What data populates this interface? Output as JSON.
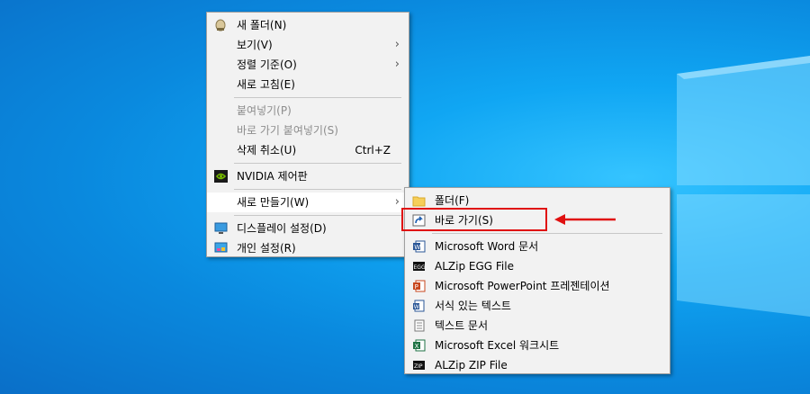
{
  "context_menu": {
    "items": [
      {
        "label": "새 폴더(N)",
        "icon": "new-folder-icon"
      },
      {
        "label": "보기(V)",
        "submenu": true
      },
      {
        "label": "정렬 기준(O)",
        "submenu": true
      },
      {
        "label": "새로 고침(E)"
      },
      {
        "label": "붙여넣기(P)",
        "disabled": true
      },
      {
        "label": "바로 가기 붙여넣기(S)",
        "disabled": true
      },
      {
        "label": "삭제 취소(U)",
        "shortcut": "Ctrl+Z"
      },
      {
        "label": "NVIDIA 제어판",
        "icon": "nvidia-icon"
      },
      {
        "label": "새로 만들기(W)",
        "submenu": true,
        "highlighted": true
      },
      {
        "label": "디스플레이 설정(D)",
        "icon": "display-icon"
      },
      {
        "label": "개인 설정(R)",
        "icon": "personalize-icon"
      }
    ]
  },
  "new_submenu": {
    "items": [
      {
        "label": "폴더(F)",
        "icon": "folder-icon"
      },
      {
        "label": "바로 가기(S)",
        "icon": "shortcut-icon",
        "highlighted": true
      },
      {
        "label": "Microsoft Word 문서",
        "icon": "word-icon"
      },
      {
        "label": "ALZip EGG File",
        "icon": "egg-icon"
      },
      {
        "label": "Microsoft PowerPoint 프레젠테이션",
        "icon": "powerpoint-icon"
      },
      {
        "label": "서식 있는 텍스트",
        "icon": "rtf-icon"
      },
      {
        "label": "텍스트 문서",
        "icon": "text-document-icon"
      },
      {
        "label": "Microsoft Excel 워크시트",
        "icon": "excel-icon"
      },
      {
        "label": "ALZip ZIP File",
        "icon": "zip-icon"
      }
    ]
  },
  "annotation": {
    "highlight_color": "#e01010"
  },
  "colors": {
    "desktop": "#0a89de",
    "menu_bg": "#f2f2f2"
  }
}
